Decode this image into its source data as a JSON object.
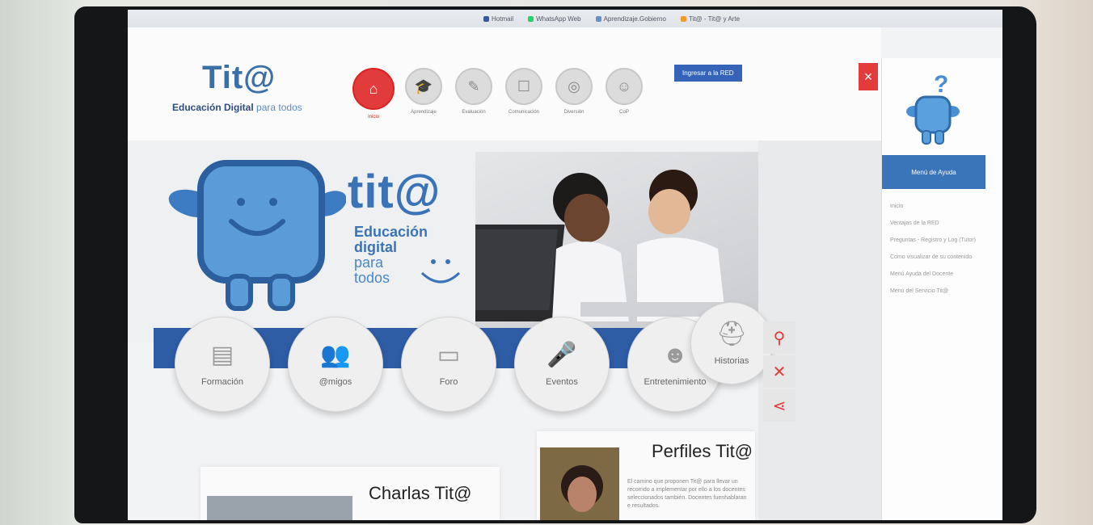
{
  "browser": {
    "bookmarks": [
      "Hotmail",
      "WhatsApp Web",
      "Aprendizaje.Gobierno",
      "Tit@ - Tit@ y Arte"
    ]
  },
  "header": {
    "logo_word": "Tit@",
    "logo_tagline_main": "Educación Digital",
    "logo_tagline_accent": "para todos",
    "login_button": "Ingresar a la RED",
    "close_label": "×",
    "nav": [
      {
        "label": "Inicio",
        "icon": "home-icon",
        "active": true
      },
      {
        "label": "Aprendizaje",
        "icon": "graduation-cap-icon"
      },
      {
        "label": "Evaluación",
        "icon": "pencil-icon"
      },
      {
        "label": "Comunicación",
        "icon": "chat-icon"
      },
      {
        "label": "Diversión",
        "icon": "gamepad-icon"
      },
      {
        "label": "CoP",
        "icon": "group-icon"
      }
    ]
  },
  "hero": {
    "title": "tit@",
    "line1": "Educación",
    "line2": "digital",
    "line3": "para",
    "line4": "todos"
  },
  "sections": [
    {
      "label": "Formación",
      "icon": "notebook-icon"
    },
    {
      "label": "@migos",
      "icon": "people-icon"
    },
    {
      "label": "Foro",
      "icon": "speech-bubbles-icon"
    },
    {
      "label": "Eventos",
      "icon": "microphone-icon"
    },
    {
      "label": "Entretenimiento",
      "icon": "theater-masks-icon"
    },
    {
      "label": "Historias",
      "icon": "chef-hat-icon"
    }
  ],
  "tools": [
    {
      "icon": "search-icon",
      "glyph": "⚲"
    },
    {
      "icon": "tools-icon",
      "glyph": "✕"
    },
    {
      "icon": "share-icon",
      "glyph": "⋖"
    }
  ],
  "cards": {
    "perfiles_title": "Perfiles Tit@",
    "perfiles_text": "El camino que proponen Tit@ para llevar un recorrido a implementar por ello a los docentes seleccionados también. Docentes fuenhablaran e resultados.",
    "charlas_title": "Charlas Tit@"
  },
  "help_panel": {
    "heading": "Menú de Ayuda",
    "items": [
      "Inicio",
      "Ventajas de la RED",
      "Preguntas - Registro y Log (Tutor)",
      "Como visualizar de su contenido",
      "Menú Ayuda del Docente",
      "Menú del Servicio Tit@"
    ]
  },
  "colors": {
    "brand_blue": "#3a73b8",
    "accent_red": "#e23b3b",
    "stripe_blue": "#2e5da6"
  }
}
